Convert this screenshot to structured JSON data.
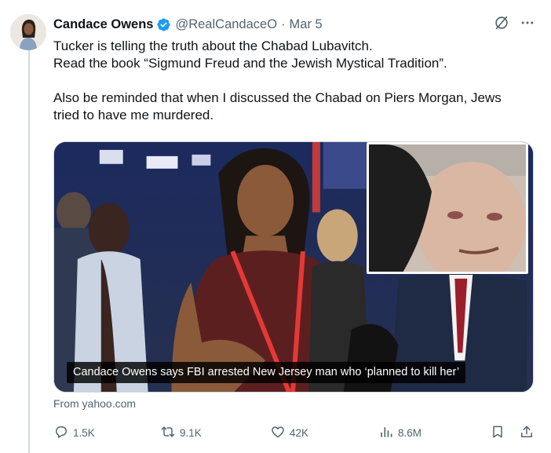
{
  "tweet": {
    "author_name": "Candace Owens",
    "handle": "@RealCandaceO",
    "separator": "·",
    "date": "Mar 5",
    "text_lines": [
      "Tucker is telling the truth about the Chabad Lubavitch.",
      "Read the book “Sigmund Freud and the Jewish Mystical Tradition”.",
      "Also be reminded that when I discussed the Chabad on Piers Morgan, Jews",
      "tried to have me murdered."
    ],
    "media_caption": "Candace Owens says FBI arrested New Jersey man who ‘planned to kill her’",
    "link_source": "From yahoo.com"
  },
  "icons": {
    "verified": "verified-badge-icon",
    "grok": "grok-icon",
    "more": "more-icon",
    "reply": "reply-icon",
    "retweet": "retweet-icon",
    "like": "like-icon",
    "views": "views-icon",
    "bookmark": "bookmark-icon",
    "share": "share-icon"
  },
  "actions": {
    "replies": "1.5K",
    "retweets": "9.1K",
    "likes": "42K",
    "views": "8.6M"
  },
  "colors": {
    "verified_blue": "#1d9bf0",
    "secondary_text": "#536471",
    "primary_text": "#0f1419",
    "thread_line": "#cfd9de"
  }
}
